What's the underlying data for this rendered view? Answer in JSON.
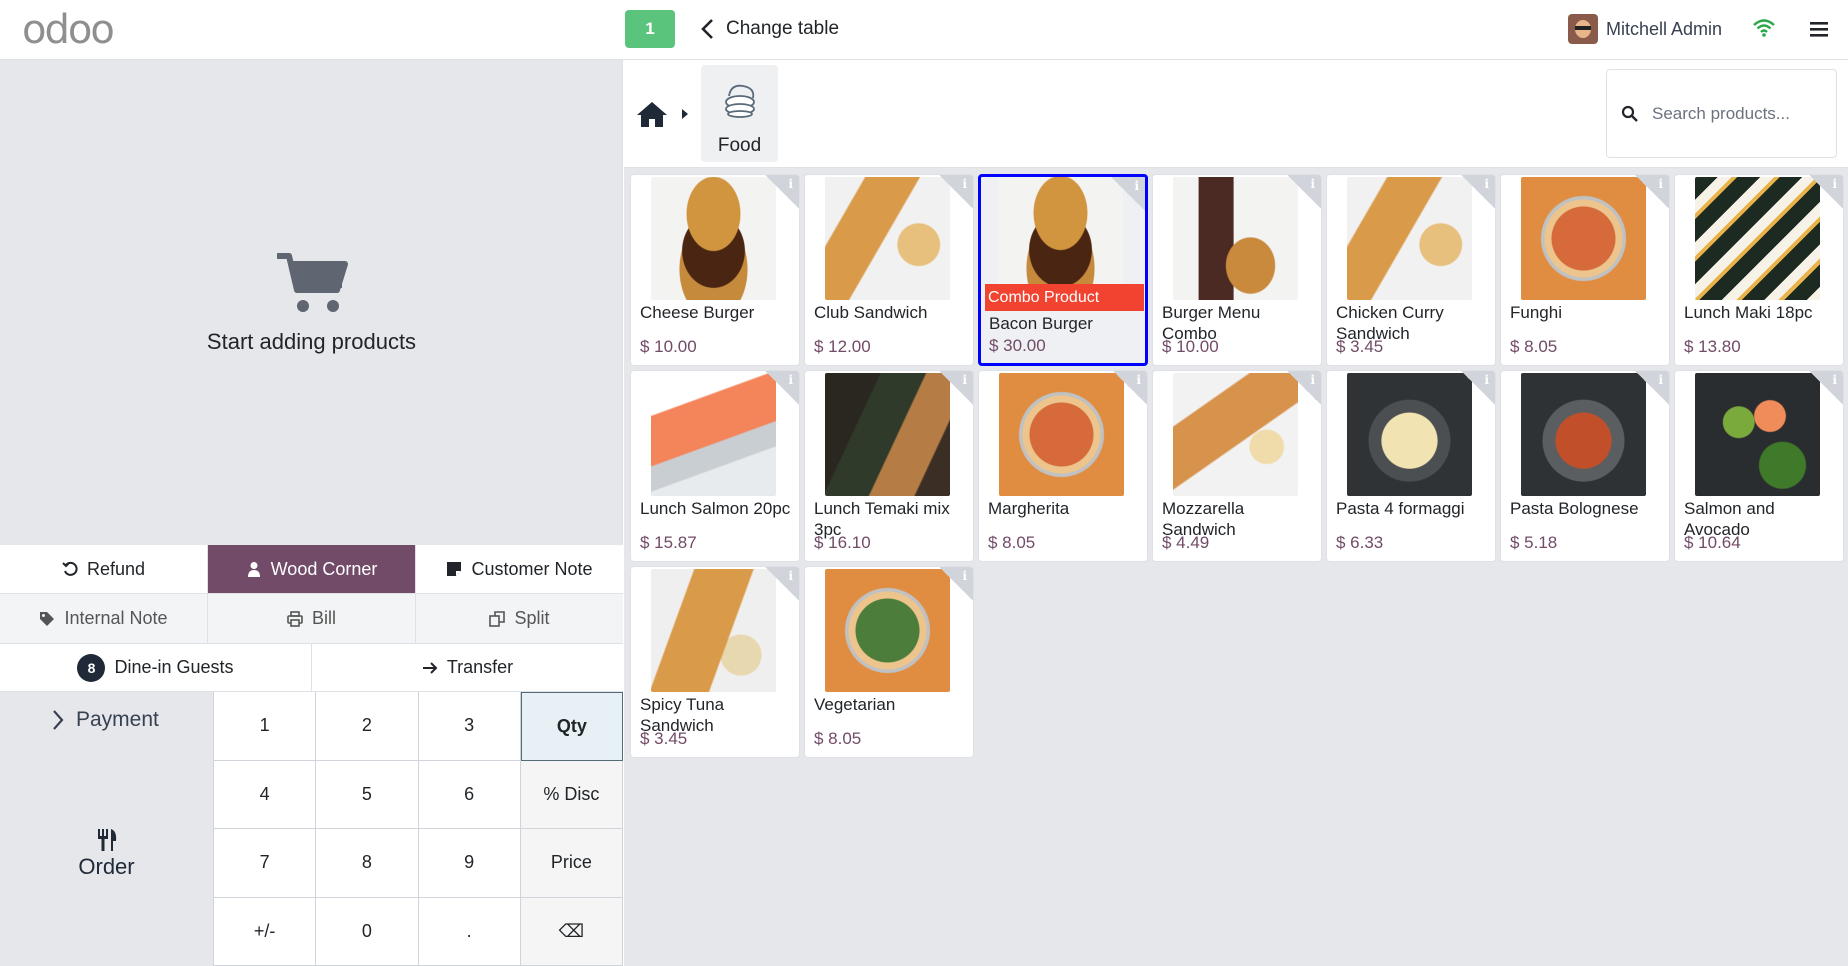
{
  "topbar": {
    "logo": "odoo",
    "table_number": "1",
    "change_table_label": "Change table",
    "user_name": "Mitchell Admin"
  },
  "left": {
    "empty_text": "Start adding products",
    "controls": {
      "refund": "Refund",
      "table_name": "Wood Corner",
      "customer_note": "Customer Note",
      "internal_note": "Internal Note",
      "bill": "Bill",
      "split": "Split",
      "guests_count": "8",
      "guests_label": "Dine-in Guests",
      "transfer": "Transfer"
    },
    "payment_label": "Payment",
    "order_label": "Order",
    "numpad": [
      "1",
      "2",
      "3",
      "Qty",
      "4",
      "5",
      "6",
      "% Disc",
      "7",
      "8",
      "9",
      "Price",
      "+/-",
      "0",
      ".",
      "⌫"
    ],
    "selected_mode": "Qty"
  },
  "right": {
    "category_label": "Food",
    "search_placeholder": "Search products...",
    "combo_label": "Combo Product",
    "products": [
      {
        "name": "Cheese Burger",
        "price": "$ 10.00",
        "img": "bg-burger"
      },
      {
        "name": "Club Sandwich",
        "price": "$ 12.00",
        "img": "bg-sandwich"
      },
      {
        "name": "Bacon Burger",
        "price": "$ 30.00",
        "img": "bg-burger",
        "combo": true,
        "selected": true
      },
      {
        "name": "Burger Menu Combo",
        "price": "$ 10.00",
        "img": "bg-drink"
      },
      {
        "name": "Chicken Curry Sandwich",
        "price": "$ 3.45",
        "img": "bg-sandwich"
      },
      {
        "name": "Funghi",
        "price": "$ 8.05",
        "img": "bg-pizza"
      },
      {
        "name": "Lunch Maki 18pc",
        "price": "$ 13.80",
        "img": "bg-maki"
      },
      {
        "name": "Lunch Salmon 20pc",
        "price": "$ 15.87",
        "img": "bg-salmon"
      },
      {
        "name": "Lunch Temaki mix 3pc",
        "price": "$ 16.10",
        "img": "bg-temaki"
      },
      {
        "name": "Margherita",
        "price": "$ 8.05",
        "img": "bg-pizza"
      },
      {
        "name": "Mozzarella Sandwich",
        "price": "$ 4.49",
        "img": "bg-mozza"
      },
      {
        "name": "Pasta 4 formaggi",
        "price": "$ 6.33",
        "img": "bg-pasta"
      },
      {
        "name": "Pasta Bolognese",
        "price": "$ 5.18",
        "img": "bg-bolog"
      },
      {
        "name": "Salmon and Avocado",
        "price": "$ 10.64",
        "img": "bg-avocado"
      },
      {
        "name": "Spicy Tuna Sandwich",
        "price": "$ 3.45",
        "img": "bg-tuna"
      },
      {
        "name": "Vegetarian",
        "price": "$ 8.05",
        "img": "bg-veg"
      }
    ]
  },
  "colors": {
    "brand": "#714b67",
    "table_badge": "#5ac47d",
    "combo_label": "#f1432f",
    "selected_border": "#0000ff",
    "wifi": "#28a745"
  },
  "icons": [
    "home-icon",
    "search-icon",
    "cart-icon",
    "wifi-icon",
    "hamburger-menu-icon",
    "refund-icon",
    "user-icon",
    "note-icon",
    "tag-icon",
    "printer-icon",
    "split-icon",
    "arrow-right-icon",
    "chevron-left-icon",
    "chevron-right-icon",
    "utensils-icon",
    "info-icon"
  ]
}
